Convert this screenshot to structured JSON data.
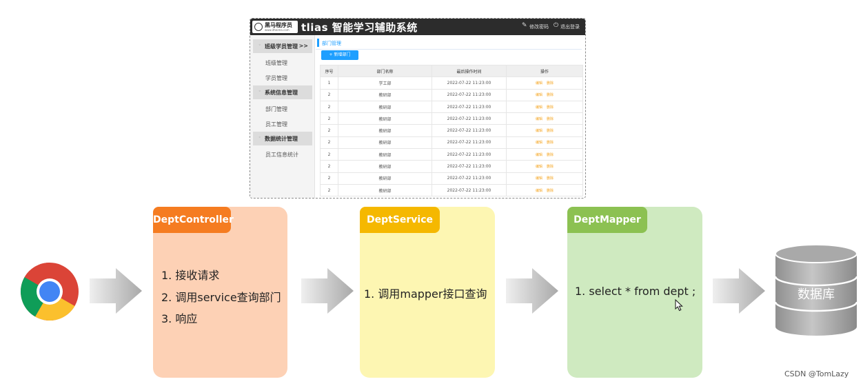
{
  "app": {
    "logo_name": "黑马程序员",
    "logo_url": "www.itheima.com",
    "title": "tlias 智能学习辅助系统",
    "header_links": {
      "change_password": "修改密码",
      "logout": "退出登录"
    },
    "sidebar": [
      {
        "group": "班级学员管理",
        "arrow": ">>",
        "items": [
          "班级管理",
          "学员管理"
        ]
      },
      {
        "group": "系统信息管理",
        "items": [
          "部门管理",
          "员工管理"
        ]
      },
      {
        "group": "数据统计管理",
        "items": [
          "员工信息统计"
        ]
      }
    ],
    "page_tab": "部门管理",
    "add_button": "+ 新增部门",
    "table": {
      "headers": [
        "序号",
        "部门名称",
        "最后操作时间",
        "操作"
      ],
      "rows": [
        {
          "index": "1",
          "name": "学工部",
          "time": "2022-07-22 11:23:00"
        },
        {
          "index": "2",
          "name": "教研部",
          "time": "2022-07-22 11:23:00"
        },
        {
          "index": "2",
          "name": "教研部",
          "time": "2022-07-22 11:23:00"
        },
        {
          "index": "2",
          "name": "教研部",
          "time": "2022-07-22 11:23:00"
        },
        {
          "index": "2",
          "name": "教研部",
          "time": "2022-07-22 11:23:00"
        },
        {
          "index": "2",
          "name": "教研部",
          "time": "2022-07-22 11:23:00"
        },
        {
          "index": "2",
          "name": "教研部",
          "time": "2022-07-22 11:23:00"
        },
        {
          "index": "2",
          "name": "教研部",
          "time": "2022-07-22 11:23:00"
        },
        {
          "index": "2",
          "name": "教研部",
          "time": "2022-07-22 11:23:00"
        },
        {
          "index": "2",
          "name": "教研部",
          "time": "2022-07-22 11:23:00"
        }
      ],
      "edit_label": "编辑",
      "delete_label": "删除"
    }
  },
  "flow": {
    "controller": {
      "title": "DeptController",
      "items": [
        "1.  接收请求",
        "2.  调用service查询部门",
        "3.  响应"
      ],
      "tab_color": "#f57c21",
      "body_color": "#fdd1b5"
    },
    "service": {
      "title": "DeptService",
      "items": [
        "1.  调用mapper接口查询"
      ],
      "tab_color": "#f5b800",
      "body_color": "#fdf6b2"
    },
    "mapper": {
      "title": "DeptMapper",
      "items": [
        "1.  select * from dept ;"
      ],
      "tab_color": "#8cc152",
      "body_color": "#cfeac0"
    },
    "database": {
      "label": "数据库"
    }
  },
  "watermark": "CSDN @TomLazy",
  "icons": [
    "chrome-browser-icon",
    "flow-arrow-icon",
    "database-cylinder-icon",
    "mouse-cursor-icon"
  ]
}
